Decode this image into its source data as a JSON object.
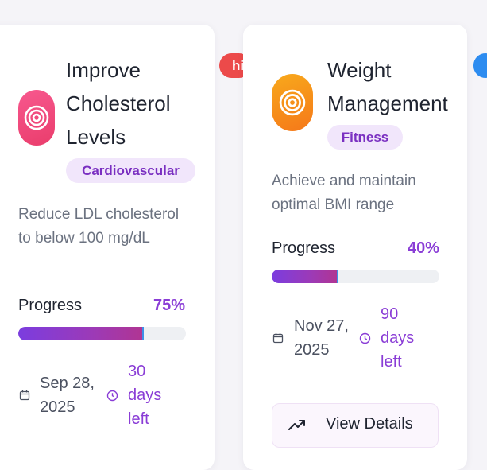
{
  "badges": {
    "left_badge_text": "hi",
    "right_badge_text": ""
  },
  "goals": [
    {
      "title": "Improve Cholesterol Levels",
      "category": "Cardiovascular",
      "description": "Reduce LDL cholesterol to below 100 mg/dL",
      "progress_label": "Progress",
      "progress_text": "75%",
      "progress_fraction": 0.75,
      "date": "Sep 28, 2025",
      "days_left": "30 days left",
      "icon": "target-icon",
      "accent_color": "#ea3d6c"
    },
    {
      "title": "Weight Management",
      "category": "Fitness",
      "description": "Achieve and maintain optimal BMI range",
      "progress_label": "Progress",
      "progress_text": "40%",
      "progress_fraction": 0.4,
      "date": "Nov 27, 2025",
      "days_left": "90 days left",
      "icon": "target-icon",
      "accent_color": "#f5781a",
      "action_label": "View Details"
    }
  ],
  "colors": {
    "progress_text": "#8a3dd6",
    "category_bg": "#f1e6fb",
    "category_text": "#7a2fc1"
  }
}
